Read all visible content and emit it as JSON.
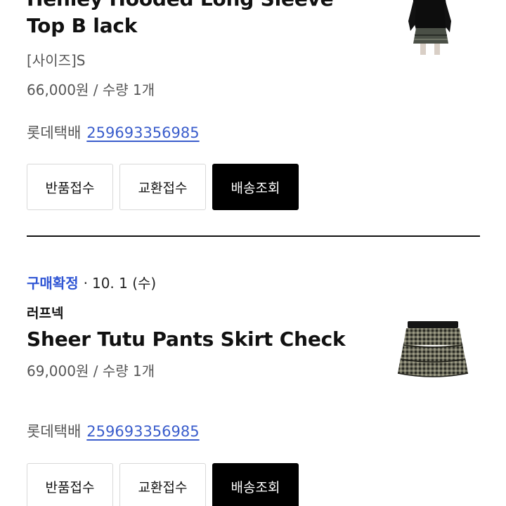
{
  "orders": [
    {
      "product_name": "Henley Hooded Long Sleeve Top B lack",
      "option": "[사이즈]S",
      "price_qty": "66,000원 / 수량 1개",
      "courier": "롯데택배",
      "tracking_number": "259693356985",
      "buttons": {
        "return": "반품접수",
        "exchange": "교환접수",
        "track": "배송조회"
      },
      "thumbnail_icon": "black-top-model-photo"
    },
    {
      "status_badge": "구매확정",
      "status_date": "10. 1 (수)",
      "brand": "러프넥",
      "product_name": "Sheer Tutu Pants Skirt Check",
      "price_qty": "69,000원 / 수량 1개",
      "courier": "롯데택배",
      "tracking_number": "259693356985",
      "buttons": {
        "return": "반품접수",
        "exchange": "교환접수",
        "track": "배송조회"
      },
      "thumbnail_icon": "tiered-check-skirt-photo"
    }
  ],
  "colors": {
    "status_blue": "#2f55d4",
    "link_blue": "#3a5dcc",
    "primary_button": "#000000"
  }
}
